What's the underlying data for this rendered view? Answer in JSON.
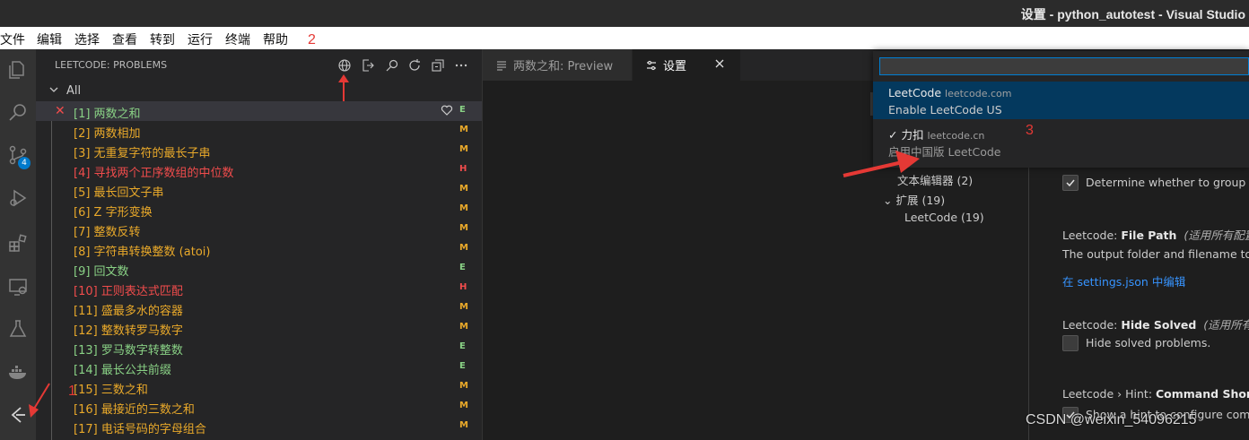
{
  "window": {
    "title": "设置 - python_autotest - Visual Studio"
  },
  "menu": [
    "文件",
    "编辑",
    "选择",
    "查看",
    "转到",
    "运行",
    "终端",
    "帮助"
  ],
  "annotations": {
    "a1": "1",
    "a2": "2",
    "a3": "3"
  },
  "activity_bar": {
    "items": [
      "explorer-icon",
      "search-icon",
      "source-control-icon",
      "run-debug-icon",
      "extensions-icon",
      "remote-explorer-icon",
      "testing-icon",
      "docker-icon",
      "leetcode-icon"
    ],
    "scm_badge": "4"
  },
  "sidebar": {
    "header": "LEETCODE: PROBLEMS",
    "toolbar_icons": [
      "globe-icon",
      "sign-in-icon",
      "search-icon",
      "refresh-icon",
      "collapse-all-icon",
      "more-icon"
    ],
    "group_label": "All",
    "problems": [
      {
        "name": "[1] 两数之和",
        "diff": "E",
        "color": "#89d185",
        "selected": true,
        "failed": true,
        "favorite": true
      },
      {
        "name": "[2] 两数相加",
        "diff": "M",
        "color": "#e9a92a"
      },
      {
        "name": "[3] 无重复字符的最长子串",
        "diff": "M",
        "color": "#e9a92a"
      },
      {
        "name": "[4] 寻找两个正序数组的中位数",
        "diff": "H",
        "color": "#f14c4c"
      },
      {
        "name": "[5] 最长回文子串",
        "diff": "M",
        "color": "#e9a92a"
      },
      {
        "name": "[6] Z 字形变换",
        "diff": "M",
        "color": "#e9a92a"
      },
      {
        "name": "[7] 整数反转",
        "diff": "M",
        "color": "#e9a92a"
      },
      {
        "name": "[8] 字符串转换整数 (atoi)",
        "diff": "M",
        "color": "#e9a92a"
      },
      {
        "name": "[9] 回文数",
        "diff": "E",
        "color": "#89d185"
      },
      {
        "name": "[10] 正则表达式匹配",
        "diff": "H",
        "color": "#f14c4c"
      },
      {
        "name": "[11] 盛最多水的容器",
        "diff": "M",
        "color": "#e9a92a"
      },
      {
        "name": "[12] 整数转罗马数字",
        "diff": "M",
        "color": "#e9a92a"
      },
      {
        "name": "[13] 罗马数字转整数",
        "diff": "E",
        "color": "#89d185"
      },
      {
        "name": "[14] 最长公共前缀",
        "diff": "E",
        "color": "#89d185"
      },
      {
        "name": "[15] 三数之和",
        "diff": "M",
        "color": "#e9a92a"
      },
      {
        "name": "[16] 最接近的三数之和",
        "diff": "M",
        "color": "#e9a92a"
      },
      {
        "name": "[17] 电话号码的字母组合",
        "diff": "M",
        "color": "#e9a92a"
      }
    ]
  },
  "tabs": [
    {
      "label": "两数之和: Preview",
      "icon": "preview-icon"
    },
    {
      "label": "设置",
      "icon": "settings-icon"
    }
  ],
  "settings_tree": {
    "text_editor": "文本编辑器 (2)",
    "extensions": "扩展 (19)",
    "leetcode": "LeetCode (19)"
  },
  "settings": {
    "group_desc": "Determine whether to group al",
    "file_path": {
      "prefix": "Leetcode: ",
      "name": "File Path",
      "scope": "(适用所有配置",
      "desc": "The output folder and filename to s",
      "link": "在 settings.json 中编辑"
    },
    "hide_solved": {
      "prefix": "Leetcode: ",
      "name": "Hide Solved",
      "scope": "(适用所有配",
      "desc": "Hide solved problems."
    },
    "hint": {
      "prefix": "Leetcode › Hint: ",
      "name": "Command Shortcu",
      "desc": "Show a hint to configure comm"
    }
  },
  "quick_pick": {
    "input_value": "",
    "items": [
      {
        "title": "LeetCode",
        "domain": "leetcode.com",
        "desc": "Enable LeetCode US",
        "active": true
      },
      {
        "title": "✓ 力扣",
        "domain": "leetcode.cn",
        "desc": "启用中国版 LeetCode",
        "active": false
      }
    ]
  },
  "watermark": "CSDN @weixin_54096215"
}
